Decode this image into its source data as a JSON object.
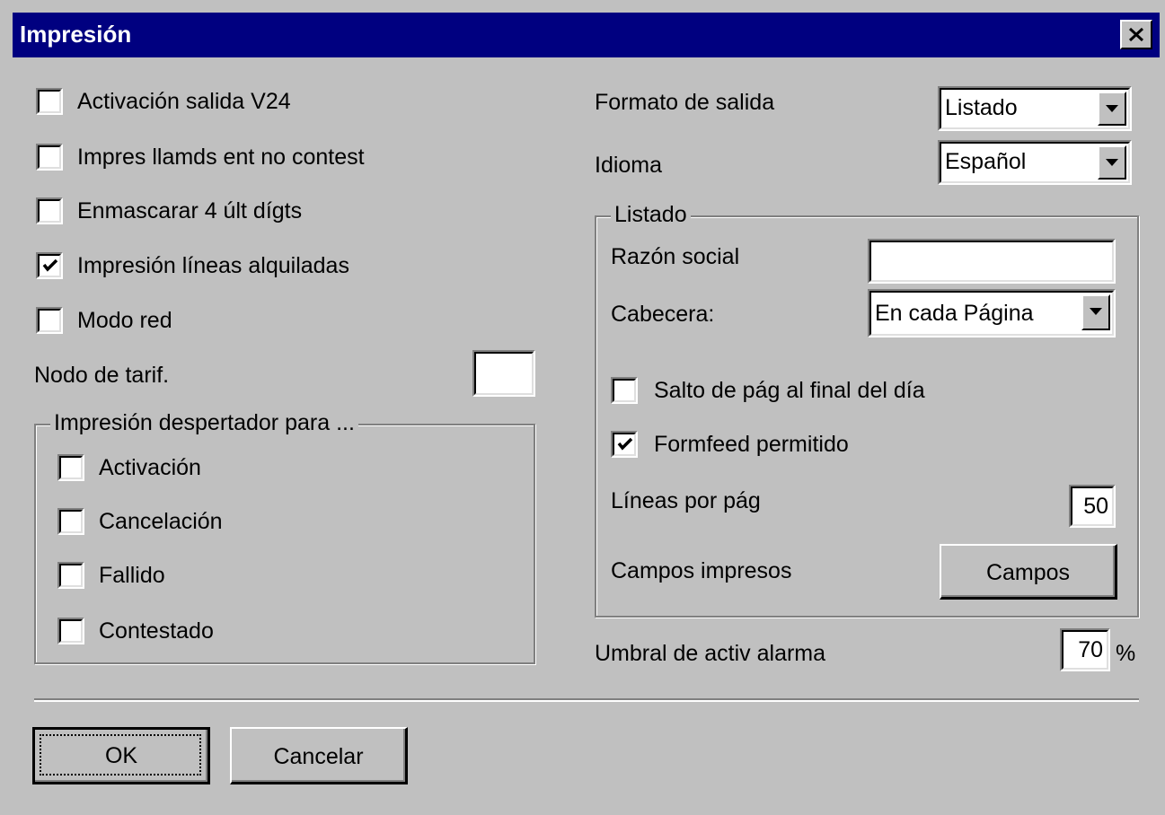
{
  "window": {
    "title": "Impresión"
  },
  "left": {
    "checkboxes": [
      {
        "label": "Activación salida V24",
        "checked": false
      },
      {
        "label": "Impres llamds ent no contest",
        "checked": false
      },
      {
        "label": "Enmascarar 4 últ dígts",
        "checked": false
      },
      {
        "label": "Impresión líneas alquiladas",
        "checked": true
      },
      {
        "label": "Modo red",
        "checked": false
      }
    ],
    "nodo_label": "Nodo de tarif.",
    "nodo_value": "",
    "alarm_group": {
      "legend": "Impresión despertador para ...",
      "checkboxes": [
        {
          "label": "Activación",
          "checked": false
        },
        {
          "label": "Cancelación",
          "checked": false
        },
        {
          "label": "Fallido",
          "checked": false
        },
        {
          "label": "Contestado",
          "checked": false
        }
      ]
    }
  },
  "right": {
    "formato_label": "Formato de salida",
    "formato_value": "Listado",
    "idioma_label": "Idioma",
    "idioma_value": "Español",
    "listado_group": {
      "legend": "Listado",
      "razon_label": "Razón social",
      "razon_value": "",
      "cabecera_label": "Cabecera:",
      "cabecera_value": "En cada Página",
      "salto_label": "Salto de pág al final del día",
      "salto_checked": false,
      "formfeed_label": "Formfeed permitido",
      "formfeed_checked": true,
      "lineas_label": "Líneas por pág",
      "lineas_value": "50",
      "campos_label": "Campos impresos",
      "campos_button": "Campos"
    },
    "umbral_label": "Umbral de activ alarma",
    "umbral_value": "70",
    "umbral_unit": "%"
  },
  "buttons": {
    "ok": "OK",
    "cancel": "Cancelar"
  }
}
